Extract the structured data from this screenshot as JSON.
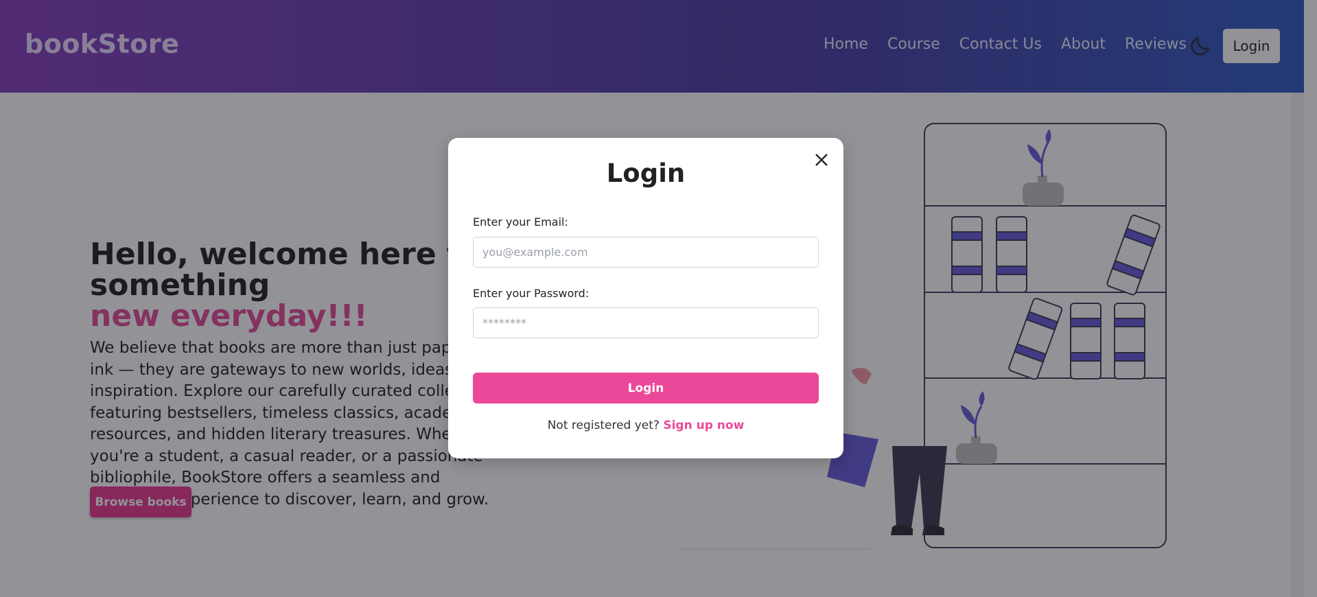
{
  "navbar": {
    "brand": "bookStore",
    "links": [
      "Home",
      "Course",
      "Contact Us",
      "About",
      "Reviews"
    ],
    "theme_icon": "moon-icon",
    "login_label": "Login"
  },
  "hero": {
    "title_line1": "Hello, welcome here to learn something",
    "title_line2": "new everyday!!!",
    "paragraph": "We believe that books are more than just paper and ink — they are gateways to new worlds, ideas, and inspiration. Explore our carefully curated collection featuring bestsellers, timeless classics, academic resources, and hidden literary treasures. Whether you're a student, a casual reader, or a passionate bibliophile, BookStore offers a seamless and enjoyable experience to discover, learn, and grow.",
    "browse_label": "Browse books"
  },
  "modal": {
    "title": "Login",
    "email_label": "Enter your Email:",
    "email_placeholder": "you@example.com",
    "email_value": "",
    "password_label": "Enter your Password:",
    "password_placeholder": "********",
    "password_value": "",
    "submit_label": "Login",
    "signup_prompt": "Not registered yet?",
    "signup_link": "Sign up now",
    "close_icon": "close-icon"
  },
  "colors": {
    "accent_pink": "#ec4899",
    "nav_gradient_start": "#7b2fb8",
    "nav_gradient_end": "#1d4fbd",
    "book_purple": "#5b4fd6"
  }
}
